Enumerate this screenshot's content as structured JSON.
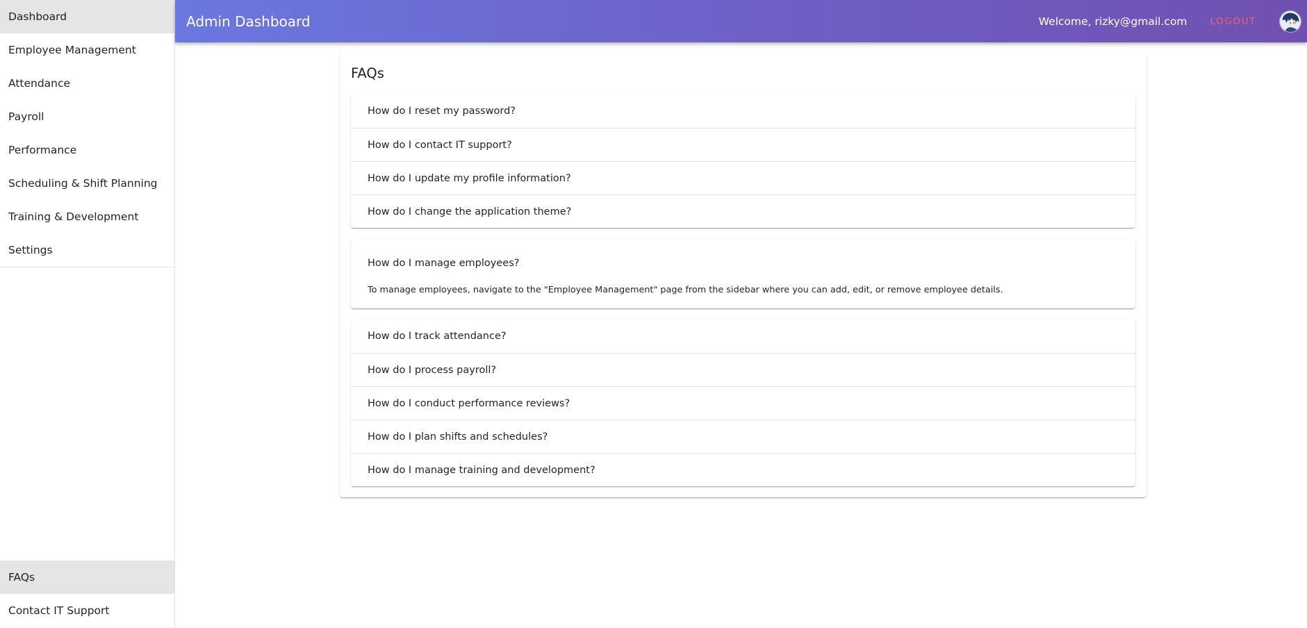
{
  "sidebar": {
    "items": [
      {
        "label": "Dashboard"
      },
      {
        "label": "Employee Management"
      },
      {
        "label": "Attendance"
      },
      {
        "label": "Payroll"
      },
      {
        "label": "Performance"
      },
      {
        "label": "Scheduling & Shift Planning"
      },
      {
        "label": "Training & Development"
      },
      {
        "label": "Settings"
      }
    ],
    "bottom_items": [
      {
        "label": "FAQs"
      },
      {
        "label": "Contact IT Support"
      }
    ]
  },
  "header": {
    "title": "Admin Dashboard",
    "welcome": "Welcome, rizky@gmail.com",
    "logout_label": "LOGOUT",
    "avatar_icon": "user-avatar"
  },
  "faq": {
    "title": "FAQs",
    "group1": [
      {
        "question": "How do I reset my password?"
      },
      {
        "question": "How do I contact IT support?"
      },
      {
        "question": "How do I update my profile information?"
      },
      {
        "question": "How do I change the application theme?"
      }
    ],
    "expanded": {
      "question": "How do I manage employees?",
      "answer": "To manage employees, navigate to the \"Employee Management\" page from the sidebar where you can add, edit, or remove employee details."
    },
    "group2": [
      {
        "question": "How do I track attendance?"
      },
      {
        "question": "How do I process payroll?"
      },
      {
        "question": "How do I conduct performance reviews?"
      },
      {
        "question": "How do I plan shifts and schedules?"
      },
      {
        "question": "How do I manage training and development?"
      }
    ]
  },
  "colors": {
    "appbar_start": "#6a78e0",
    "appbar_end": "#7050b0",
    "logout": "#f06272",
    "active_nav": "#e5e5e5"
  }
}
